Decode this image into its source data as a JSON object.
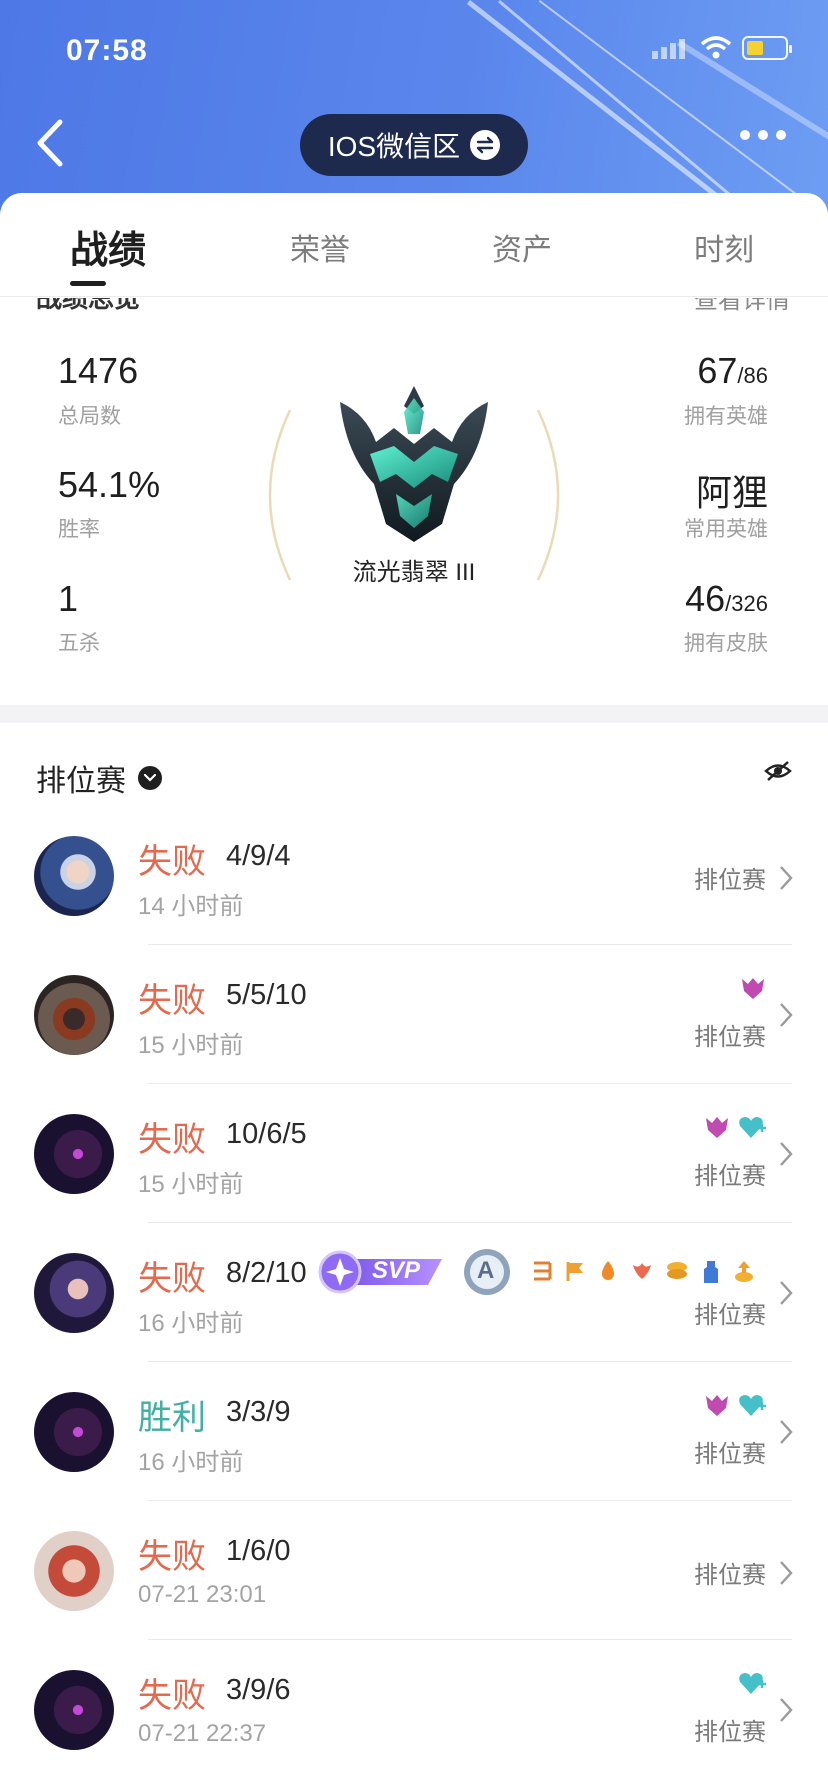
{
  "status_bar": {
    "time": "07:58"
  },
  "header": {
    "server_label": "IOS微信区"
  },
  "tabs": [
    {
      "label": "战绩",
      "active": true
    },
    {
      "label": "荣誉",
      "active": false
    },
    {
      "label": "资产",
      "active": false
    },
    {
      "label": "时刻",
      "active": false
    }
  ],
  "overview": {
    "title": "战绩总览",
    "detail_link": "查看详情",
    "total_games": {
      "value": "1476",
      "label": "总局数"
    },
    "win_rate": {
      "value": "54.1%",
      "label": "胜率"
    },
    "pentakills": {
      "value": "1",
      "label": "五杀"
    },
    "owned_heroes": {
      "value": "67",
      "total": "/86",
      "label": "拥有英雄"
    },
    "common_hero": {
      "value": "阿狸",
      "label": "常用英雄"
    },
    "owned_skins": {
      "value": "46",
      "total": "/326",
      "label": "拥有皮肤"
    },
    "rank_name": "流光翡翠 III"
  },
  "match_list": {
    "title": "排位赛",
    "items": [
      {
        "result": "失败",
        "kda": "4/9/4",
        "time": "14 小时前",
        "mode": "排位赛"
      },
      {
        "result": "失败",
        "kda": "5/5/10",
        "time": "15 小时前",
        "mode": "排位赛"
      },
      {
        "result": "失败",
        "kda": "10/6/5",
        "time": "15 小时前",
        "mode": "排位赛"
      },
      {
        "result": "失败",
        "kda": "8/2/10",
        "time": "16 小时前",
        "mode": "排位赛",
        "svp_label": "SVP",
        "rank_badge": "A"
      },
      {
        "result": "胜利",
        "kda": "3/3/9",
        "time": "16 小时前",
        "mode": "排位赛"
      },
      {
        "result": "失败",
        "kda": "1/6/0",
        "time": "07-21 23:01",
        "mode": "排位赛"
      },
      {
        "result": "失败",
        "kda": "3/9/6",
        "time": "07-21 22:37",
        "mode": "排位赛"
      }
    ]
  },
  "colors": {
    "header_blue": "#4d78e6",
    "lose": "#e26a4f",
    "win": "#3fb0a2",
    "pill": "#1d2a4d"
  }
}
